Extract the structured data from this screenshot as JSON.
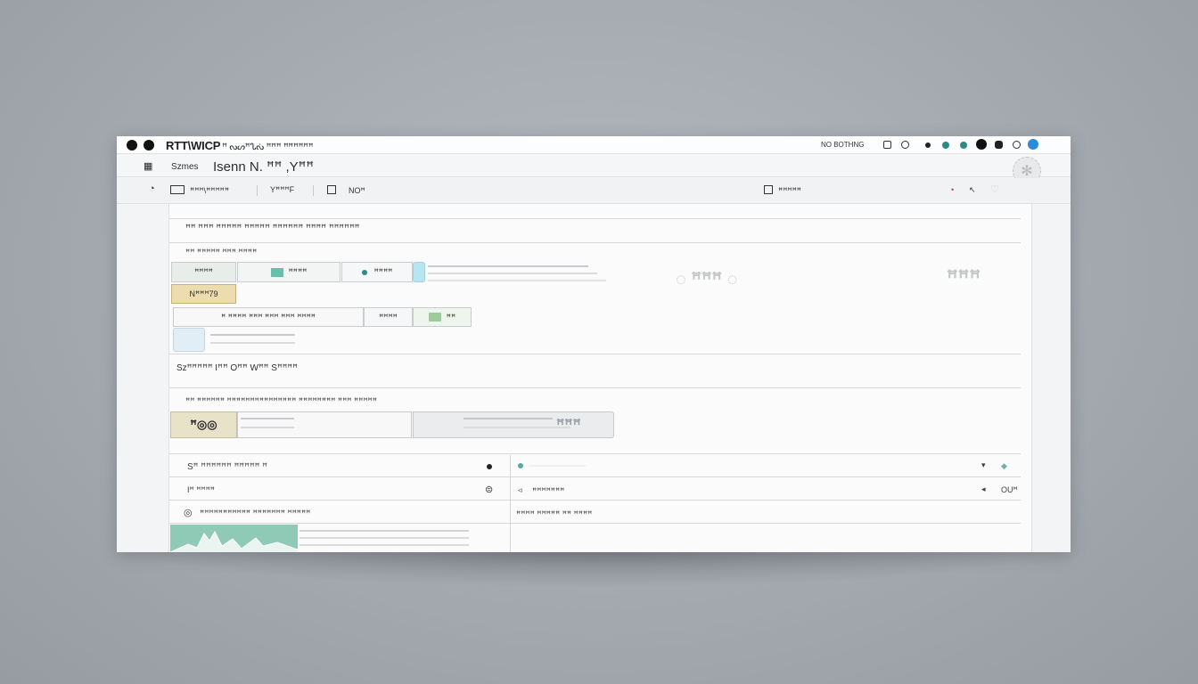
{
  "window": {
    "title": "RTT\\WICP",
    "title_sub": "ꟸ ᔓᔕꟸᔐᔔ ꟸꟸꟸ ꟸꟸꟸꟸꟸꟸ",
    "status_text": "NO BOTHNG",
    "controls": [
      "close-icon",
      "minimize-icon"
    ],
    "tray_icons": [
      "bell-icon",
      "clock-icon",
      "record-icon",
      "teal-dot-icon",
      "teal-dot-icon",
      "record-icon",
      "cloud-icon",
      "user-icon",
      "info-icon"
    ],
    "colors": {
      "teal": "#2e8a84",
      "blue": "#2a8bd6",
      "accent_green": "#8fcab6"
    }
  },
  "menubar": {
    "icon": "grid-icon",
    "item1": "Szmes",
    "title": "Isenn N. ꟸꟸ ,Yꟸꟸ"
  },
  "toolbar": {
    "item1": "ꟸꟸꟸ\\ꟸꟸꟸꟸꟸ",
    "item2": "YꟸꟸꟸF",
    "item3": "NOꟸ",
    "right_label": "ꟸꟸꟸꟸꟸ"
  },
  "section1": {
    "header": "ꟸꟸ ꟸꟸꟸ   ꟸꟸꟸꟸꟸ ꟸꟸꟸꟸꟸ ꟸꟸꟸꟸꟸꟸ ꟸꟸꟸꟸ ꟸꟸꟸꟸꟸꟸ",
    "sub": "ꟸꟸ ꟸꟸꟸꟸꟸ ꟸꟸꟸ   ꟸꟸꟸꟸ",
    "row1": [
      "ꟸꟸꟸꟸ",
      "ꟸꟸꟸꟸ",
      "ꟸꟸꟸꟸ"
    ],
    "row1_tag": "Nꟸꟸꟸ79",
    "row2": [
      "ꟸ ꟸꟸꟸꟸ ꟸꟸꟸ ꟸꟸꟸ ꟸꟸꟸ ꟸꟸꟸꟸ",
      "ꟸꟸꟸꟸ",
      "ꟸꟸ"
    ],
    "ghost1": "◌ ꟸꟸꟸ ◌",
    "ghost2": "ꟸꟸꟸ"
  },
  "section2": {
    "header": "Szꟸꟸꟸꟸꟸ   Iꟸꟸ Oꟸꟸ Wꟸꟸ Sꟸꟸꟸꟸ",
    "sub": "ꟸꟸ ꟸꟸꟸꟸꟸꟸ ꟸꟸꟸꟸꟸꟸꟸꟸꟸꟸꟸꟸꟸꟸꟸ ꟸꟸꟸꟸꟸꟸꟸꟸ ꟸꟸꟸ ꟸꟸꟸꟸꟸ",
    "badge": "ꟸ◎◎",
    "ghost3": "ꟸꟸꟸ"
  },
  "table": {
    "left_rows": [
      "Sꟸ ꟸꟸꟸꟸꟸꟸ ꟸꟸꟸꟸꟸ   ꟸ",
      "Iꟸ   ꟸꟸꟸꟸ",
      "ꟸꟸꟸꟸꟸꟸꟸꟸꟸꟸꟸ ꟸꟸꟸꟸꟸꟸꟸ ꟸꟸꟸꟸꟸ"
    ],
    "right_rows": [
      "",
      "ꟸꟸꟸꟸꟸꟸꟸ",
      "ꟸꟸꟸꟸ ꟸꟸꟸꟸꟸ ꟸꟸ ꟸꟸꟸꟸ"
    ],
    "right_end": "OUꟸ"
  }
}
